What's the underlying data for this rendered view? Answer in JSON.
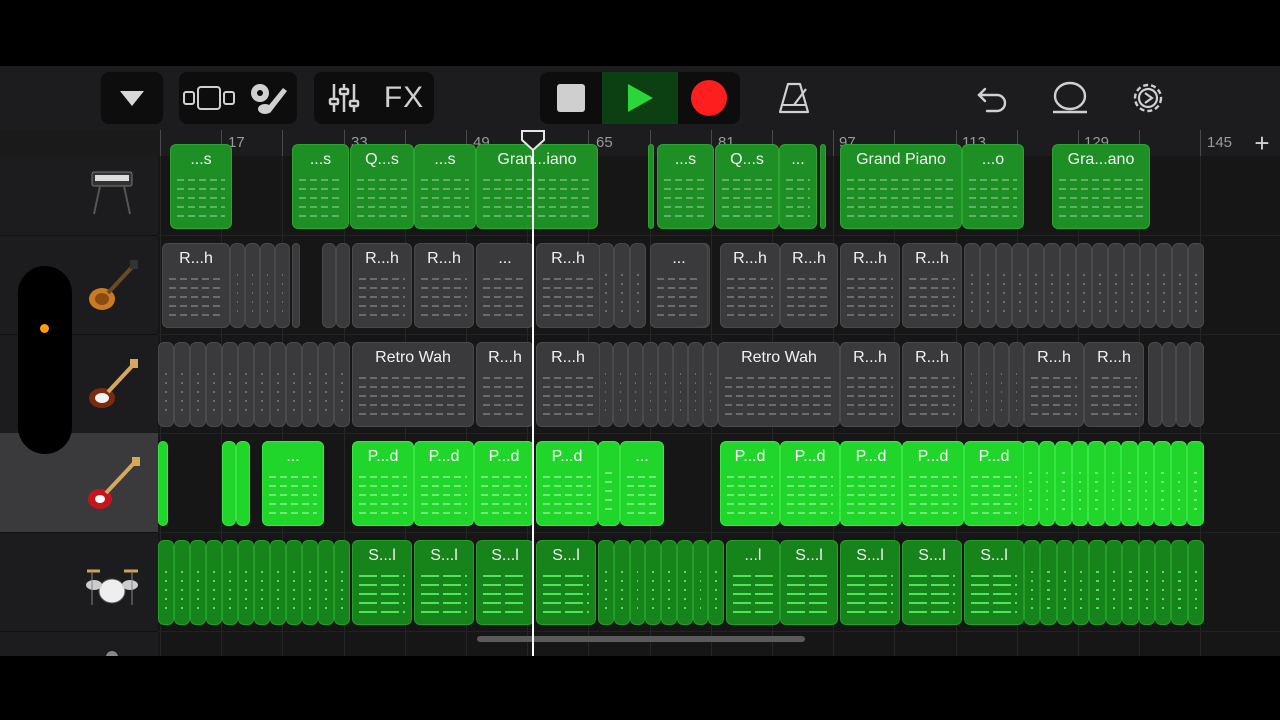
{
  "toolbar": {
    "browser_icon": "triangle-down-icon",
    "tracks_view_icon": "tracks-view-icon",
    "instrument_icon": "guitar-gear-icon",
    "mixer_icon": "mixer-sliders-icon",
    "fx_label": "FX",
    "stop_icon": "stop-icon",
    "play_icon": "play-icon",
    "record_icon": "record-icon",
    "metronome_icon": "metronome-icon",
    "undo_icon": "undo-icon",
    "loop_icon": "loop-browser-icon",
    "settings_icon": "settings-gear-icon",
    "colors": {
      "play_active": "#0c3f12",
      "play_arrow": "#2bd63a",
      "record": "#ff1e1e",
      "stop": "#cfcfcf"
    }
  },
  "ruler": {
    "bars": [
      "17",
      "33",
      "49",
      "65",
      "81",
      "97",
      "113",
      "129",
      "145"
    ]
  },
  "add_track_label": "+",
  "tracks": [
    {
      "instrument": "keyboard-icon",
      "regions": [
        {
          "label": "...s"
        },
        {
          "label": "...s"
        },
        {
          "label": "Q...s"
        },
        {
          "label": "...s"
        },
        {
          "label": "Gran...iano"
        },
        {
          "label": "...s"
        },
        {
          "label": "Q...s"
        },
        {
          "label": "..."
        },
        {
          "label": "Grand Piano"
        },
        {
          "label": "...o"
        },
        {
          "label": "Gra...ano"
        }
      ]
    },
    {
      "instrument": "electric-guitar-icon",
      "regions": [
        {
          "label": "R...h"
        },
        {
          "label": "R...h"
        },
        {
          "label": "R...h"
        },
        {
          "label": "..."
        },
        {
          "label": "R...h"
        },
        {
          "label": "..."
        },
        {
          "label": "R...h"
        },
        {
          "label": "R...h"
        },
        {
          "label": "R...h"
        },
        {
          "label": "R...h"
        }
      ]
    },
    {
      "instrument": "stratocaster-guitar-icon",
      "regions": [
        {
          "label": "Retro Wah"
        },
        {
          "label": "R...h"
        },
        {
          "label": "R...h"
        },
        {
          "label": "Retro Wah"
        },
        {
          "label": "R...h"
        },
        {
          "label": "R...h"
        },
        {
          "label": "R...h"
        },
        {
          "label": "R...h"
        }
      ]
    },
    {
      "instrument": "bass-guitar-icon",
      "selected": true,
      "regions": [
        {
          "label": "..."
        },
        {
          "label": "P...d"
        },
        {
          "label": "P...d"
        },
        {
          "label": "P...d"
        },
        {
          "label": "P...d"
        },
        {
          "label": "..."
        },
        {
          "label": "P...d"
        },
        {
          "label": "P...d"
        },
        {
          "label": "P...d"
        },
        {
          "label": "P...d"
        },
        {
          "label": "P...d"
        }
      ]
    },
    {
      "instrument": "drum-kit-icon",
      "regions": [
        {
          "label": "S...l"
        },
        {
          "label": "S...l"
        },
        {
          "label": "S...l"
        },
        {
          "label": "S...l"
        },
        {
          "label": "...l"
        },
        {
          "label": "S...l"
        },
        {
          "label": "S...l"
        },
        {
          "label": "S...l"
        },
        {
          "label": "S...l"
        }
      ]
    }
  ]
}
